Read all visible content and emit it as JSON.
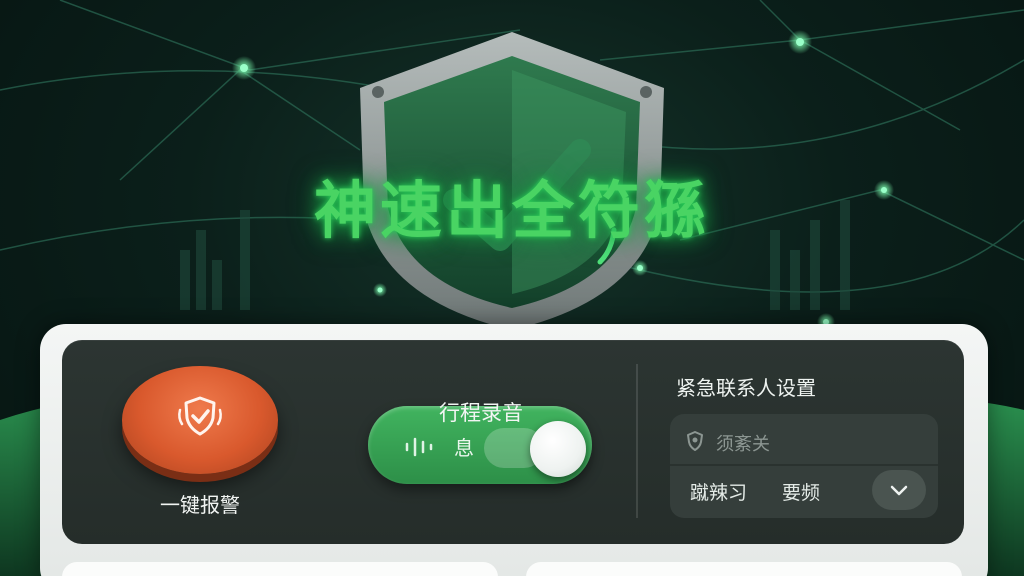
{
  "hero": {
    "title": "神速出全符猻"
  },
  "colors": {
    "accent_green": "#49d463",
    "toggle_green": "#3aa857",
    "alarm_orange": "#e0633a",
    "panel_dark": "#2a3330"
  },
  "alarm": {
    "icon": "shield-check-icon",
    "label": "一键报警"
  },
  "recording": {
    "title": "行程录音",
    "state_text": "息",
    "wave_icon": "audio-wave-icon"
  },
  "contacts": {
    "title": "紧急联系人设置",
    "input_icon": "contact-shield-icon",
    "placeholder": "须紊关",
    "chips": [
      "蹴辣习",
      "要频"
    ],
    "dropdown_icon": "chevron-down-icon"
  }
}
